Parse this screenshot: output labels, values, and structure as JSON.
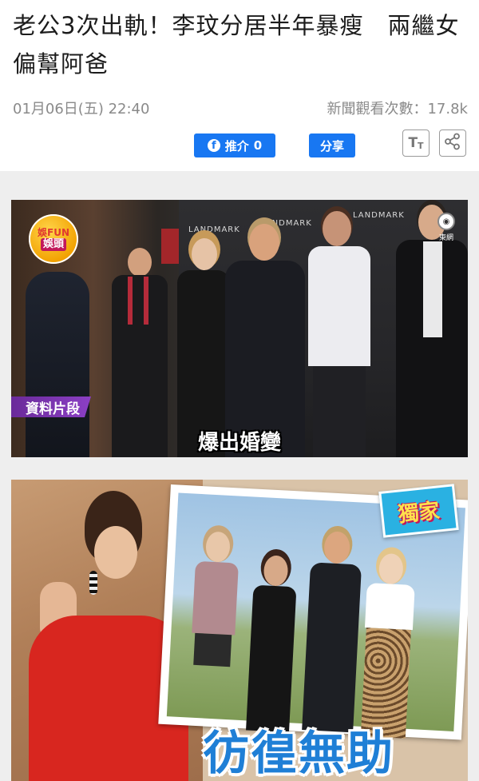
{
  "article": {
    "title": "老公3次出軌！李玟分居半年暴瘦　兩繼女偏幫阿爸",
    "date": "01月06日(五) 22:40",
    "views_label": "新聞觀看次數：17.8k"
  },
  "actions": {
    "like_label": "推介",
    "like_count": "0",
    "share_label": "分享",
    "fb_glyph": "f",
    "font_size_glyph": "T",
    "font_size_glyph_small": "T"
  },
  "icons": {
    "facebook": "facebook-icon",
    "font_size": "font-size-icon",
    "share": "share-icon"
  },
  "colors": {
    "accent": "#1877f2",
    "meta_text": "#8a8a8a",
    "archive_label_bg": "#7b35b5",
    "caption_blue": "#1f7fd6",
    "exclusive_bg": "#2ab1e2"
  },
  "video": {
    "show_logo_top": "娛FUN",
    "show_logo_bottom": "娛頭",
    "channel_mark": "東網",
    "archive_label": "資料片段",
    "subtitle": "爆出婚變",
    "backdrop_brand": "LANDMARK"
  },
  "collage": {
    "exclusive_badge": "獨家",
    "caption": "彷徨無助"
  }
}
